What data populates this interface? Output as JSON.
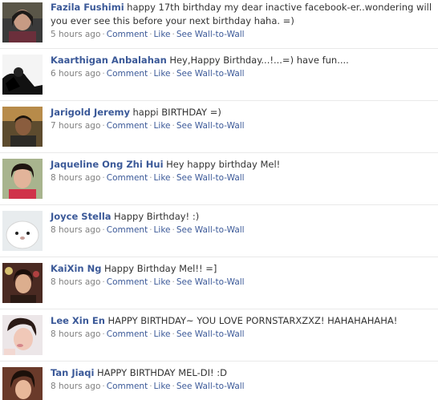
{
  "posts": [
    {
      "author": "Fazila Fushimi",
      "message": "happy 17th birthday my dear inactive facebook-er..wondering will you ever see this before your next birthday haha. =)",
      "time": "5 hours ago",
      "avatar_icon": "profile-photo"
    },
    {
      "author": "Kaarthigan Anbalahan",
      "message": "Hey,Happy Birthday...!...=) have fun....",
      "time": "6 hours ago",
      "avatar_icon": "profile-photo"
    },
    {
      "author": "Jarigold Jeremy",
      "message": "happi BIRTHDAY =)",
      "time": "7 hours ago",
      "avatar_icon": "profile-photo"
    },
    {
      "author": "Jaqueline Ong Zhi Hui",
      "message": "Hey happy birthday Mel!",
      "time": "8 hours ago",
      "avatar_icon": "profile-photo"
    },
    {
      "author": "Joyce Stella",
      "message": "Happy Birthday! :)",
      "time": "8 hours ago",
      "avatar_icon": "profile-photo"
    },
    {
      "author": "KaiXin Ng",
      "message": "Happy Birthday Mel!! =]",
      "time": "8 hours ago",
      "avatar_icon": "profile-photo"
    },
    {
      "author": "Lee Xin En",
      "message": "HAPPY BIRTHDAY~ YOU LOVE PORNSTARXZXZ! HAHAHAHAHA!",
      "time": "8 hours ago",
      "avatar_icon": "profile-photo"
    },
    {
      "author": "Tan Jiaqi",
      "message": "HAPPY BIRTHDAY MEL-DI! :D",
      "time": "8 hours ago",
      "avatar_icon": "profile-photo"
    }
  ],
  "actions": {
    "comment": "Comment",
    "like": "Like",
    "wall_to_wall": "See Wall-to-Wall",
    "separator": "·"
  },
  "colors": {
    "link": "#3b5998",
    "meta": "#808080",
    "divider": "#e9e9e9"
  }
}
